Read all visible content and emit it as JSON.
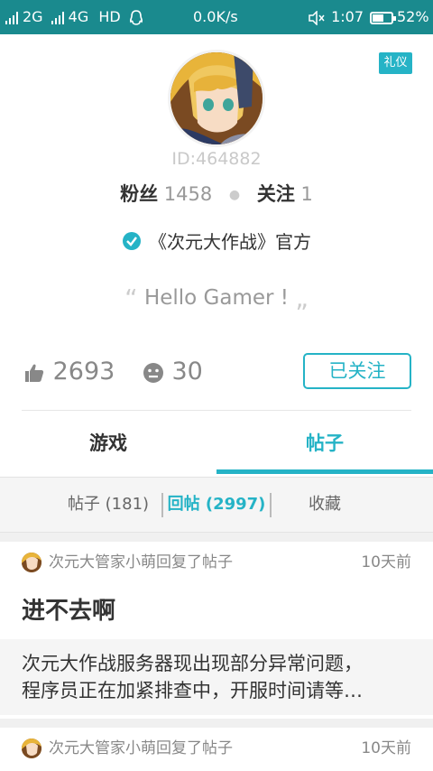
{
  "status_bar": {
    "network_1": "2G",
    "network_2": "4G",
    "hd": "HD",
    "speed": "0.0K/s",
    "time": "1:07",
    "battery": "52%"
  },
  "profile": {
    "etiquette_badge": "礼仪",
    "user_id": "ID:464882",
    "fans_label": "粉丝",
    "fans_count": "1458",
    "following_label": "关注",
    "following_count": "1",
    "official_text": "《次元大作战》官方",
    "motto": "Hello Gamer !",
    "likes": "2693",
    "dislikes": "30",
    "follow_button": "已关注"
  },
  "tabs": [
    "游戏",
    "帖子"
  ],
  "subtabs": [
    "帖子 (181)",
    "回帖 (2997)",
    "收藏"
  ],
  "posts": [
    {
      "meta": "次元大管家小萌回复了帖子",
      "time": "10天前",
      "title": "进不去啊",
      "body_line1": "次元大作战服务器现出现部分异常问题，",
      "body_line2": "程序员正在加紧排查中，开服时间请等…"
    },
    {
      "meta": "次元大管家小萌回复了帖子",
      "time": "10天前"
    }
  ],
  "colors": {
    "status_bar": "#1a8a8e",
    "accent": "#25b3c6"
  }
}
